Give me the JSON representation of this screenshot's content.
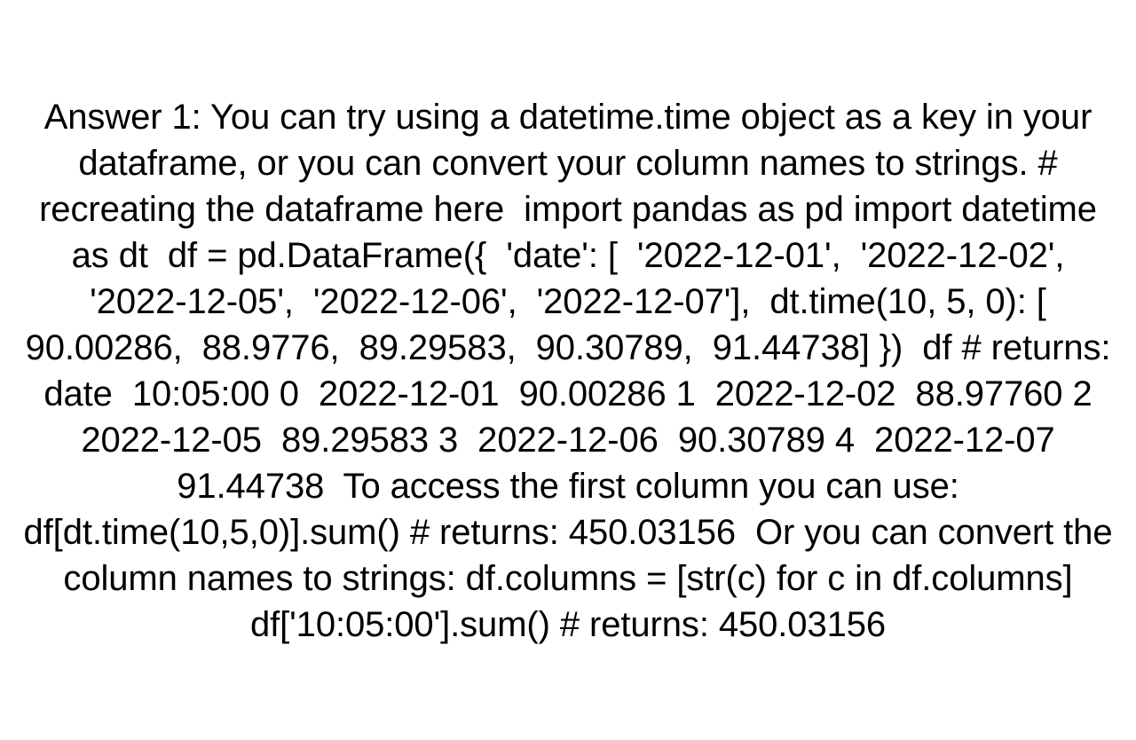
{
  "page": {
    "kind": "plain-text-answer",
    "background_color": "#ffffff",
    "text_color": "#000000"
  },
  "answer": {
    "label": "Answer 1:",
    "full_text": "Answer 1: You can try using a datetime.time object as a key in your dataframe, or you can convert your column names to strings. # recreating the dataframe here  import pandas as pd import datetime as dt  df = pd.DataFrame({  'date': [  '2022-12-01',  '2022-12-02',  '2022-12-05',  '2022-12-06',  '2022-12-07'],  dt.time(10, 5, 0): [  90.00286,  88.9776,  89.29583,  90.30789,  91.44738] })  df # returns:        date  10:05:00 0  2022-12-01  90.00286 1  2022-12-02  88.97760 2  2022-12-05  89.29583 3  2022-12-06  90.30789 4  2022-12-07  91.44738  To access the first column you can use: df[dt.time(10,5,0)].sum() # returns: 450.03156  Or you can convert the column names to strings: df.columns = [str(c) for c in df.columns] df['10:05:00'].sum() # returns: 450.03156",
    "lines": [
      "Answer 1: You can try using a datetime.time object as a key",
      "in your dataframe, or you can convert your column names to",
      "strings. # recreating the dataframe here  import pandas as",
      "pd import datetime as dt  df = pd.DataFrame({  'date': [",
      "'2022-12-01',  '2022-12-02',  '2022-12-05',",
      "'2022-12-06',  '2022-12-07'],  dt.time(10, 5, 0): [",
      "90.00286,  88.9776,  89.29583,  90.30789,  91.44738] })",
      "df # returns:        date  10:05:00 0  2022-12-01",
      "90.00286 1  2022-12-02  88.97760 2  2022-12-05  89.29583 3",
      "2022-12-06  90.30789 4  2022-12-07  91.44738  To access the",
      "first column you can use: df[dt.time(10,5,0)].sum() #",
      "returns: 450.03156  Or you can convert the column names to",
      "strings: df.columns = [str(c) for c in df.columns]",
      "df['10:05:00'].sum() # returns: 450.03156"
    ],
    "code": {
      "imports": [
        "import pandas as pd",
        "import datetime as dt"
      ],
      "comment_recreating": "# recreating the dataframe here",
      "dataframe_constructor": "df = pd.DataFrame({  'date': [  '2022-12-01',  '2022-12-02',  '2022-12-05',  '2022-12-06',  '2022-12-07'],  dt.time(10, 5, 0): [  90.00286,  88.9776,  89.29583,  90.30789,  91.44738] })",
      "access_first_column": "df[dt.time(10,5,0)].sum()",
      "convert_columns": "df.columns = [str(c) for c in df.columns]",
      "access_by_string": "df['10:05:00'].sum()",
      "sum_result": "450.03156",
      "time_key": "dt.time(10, 5, 0)",
      "time_string": "10:05:00"
    },
    "dataframe": {
      "index_name": "",
      "columns": [
        "date",
        "10:05:00"
      ],
      "rows": [
        {
          "index": "0",
          "date": "2022-12-01",
          "value": "90.00286"
        },
        {
          "index": "1",
          "date": "2022-12-02",
          "value": "88.97760"
        },
        {
          "index": "2",
          "date": "2022-12-05",
          "value": "89.29583"
        },
        {
          "index": "3",
          "date": "2022-12-06",
          "value": "90.30789"
        },
        {
          "index": "4",
          "date": "2022-12-07",
          "value": "91.44738"
        }
      ],
      "source_values": [
        "90.00286",
        "88.9776",
        "89.29583",
        "90.30789",
        "91.44738"
      ],
      "source_dates": [
        "2022-12-01",
        "2022-12-02",
        "2022-12-05",
        "2022-12-06",
        "2022-12-07"
      ]
    }
  }
}
